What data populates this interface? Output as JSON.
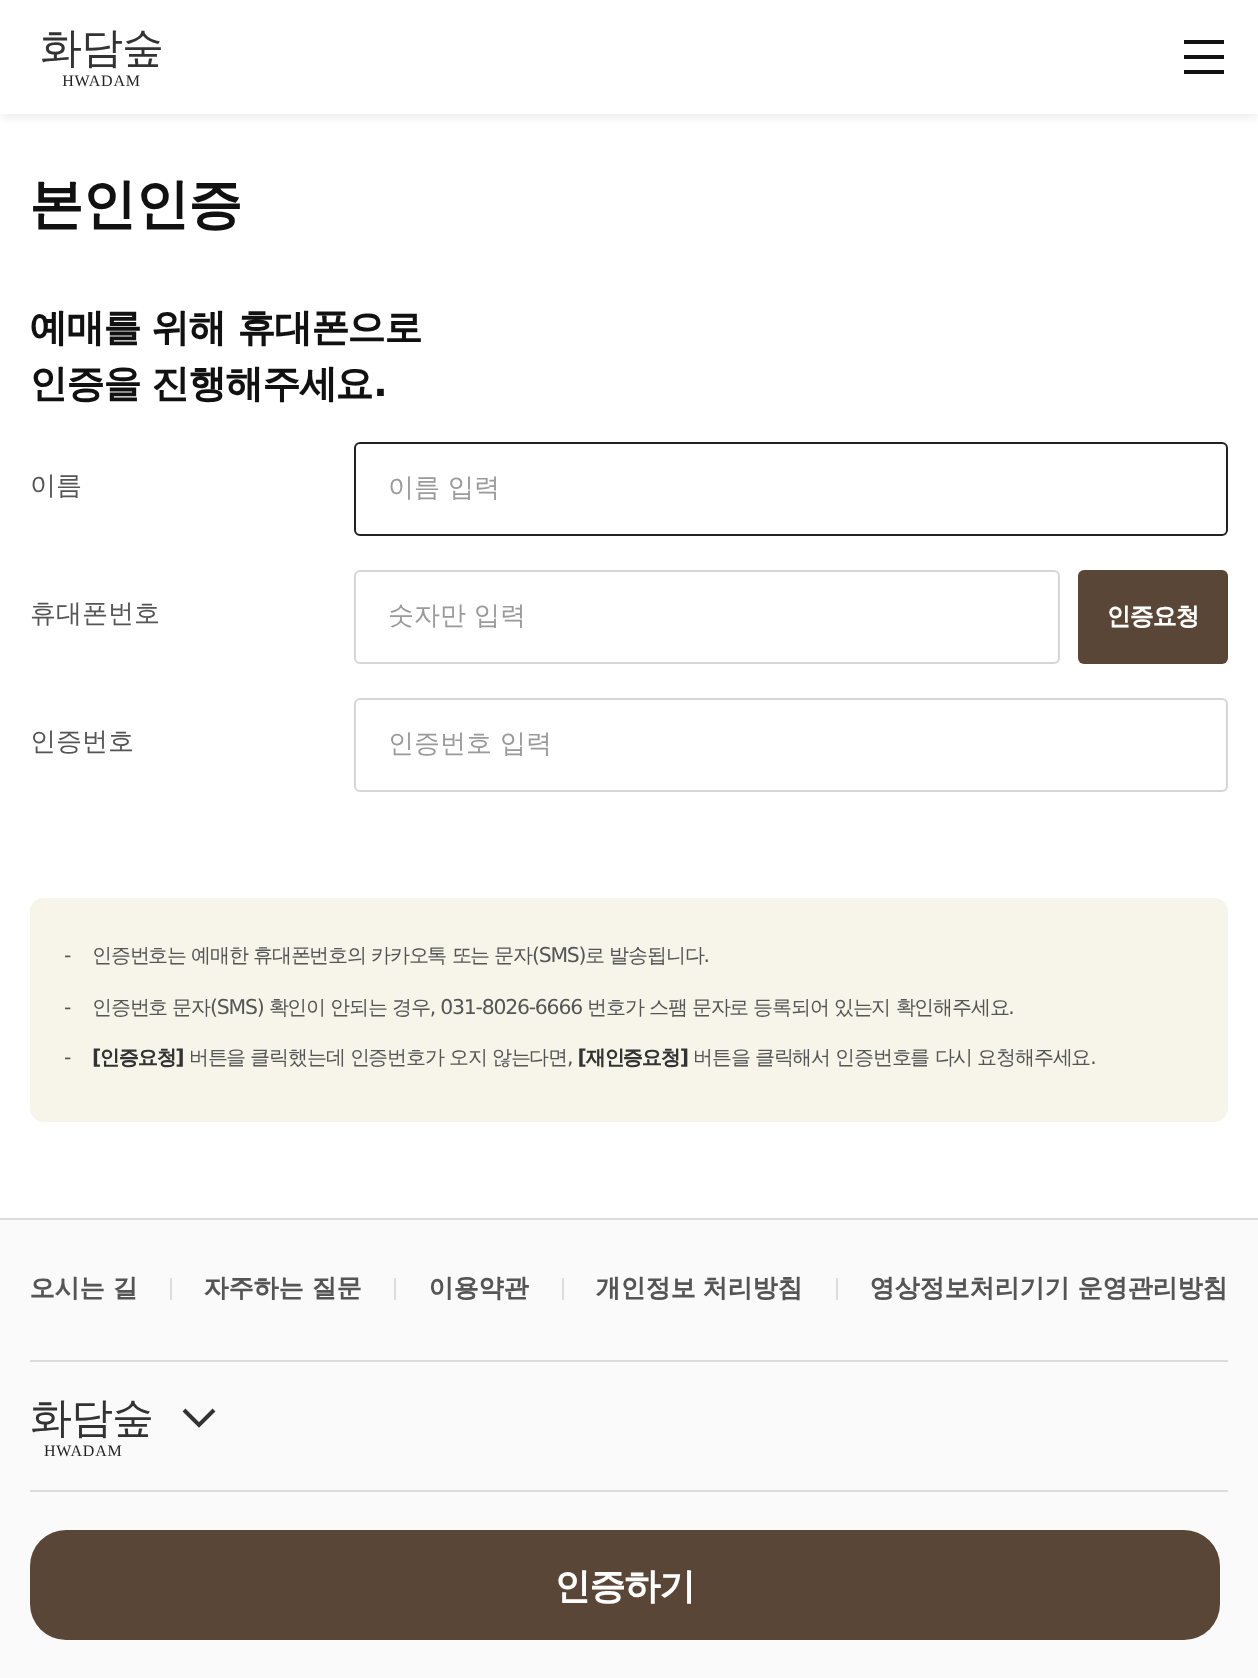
{
  "header": {
    "logo": {
      "name": "화담숲",
      "latin": "HWADAM"
    }
  },
  "page_title": "본인인증",
  "intro": "예매를 위해 휴대폰으로\n인증을 진행해주세요.",
  "form": {
    "fields": [
      {
        "label": "이름",
        "placeholder": "이름 입력",
        "focused": true
      },
      {
        "label": "휴대폰번호",
        "placeholder": "숫자만 입력",
        "focused": false,
        "button": "인증요청"
      },
      {
        "label": "인증번호",
        "placeholder": "인증번호 입력",
        "focused": false
      }
    ]
  },
  "notice": {
    "marker": "-",
    "items": [
      "인증번호는 예매한 휴대폰번호의 카카오톡 또는 문자(SMS)로 발송됩니다.",
      "인증번호 문자(SMS) 확인이 안되는 경우, 031-8026-6666 번호가 스팸 문자로 등록되어 있는지 확인해주세요.",
      "**[인증요청]** 버튼을 클릭했는데 인증번호가 오지 않는다면, **[재인증요청]** 버튼을 클릭해서 인증번호를 다시 요청해주세요."
    ]
  },
  "footer": {
    "links": [
      "오시는 길",
      "자주하는 질문",
      "이용약관",
      "개인정보 처리방침",
      "영상정보처리기기 운영관리방침"
    ],
    "logo": {
      "name": "화담숲",
      "latin": "HWADAM",
      "expanded": false
    }
  },
  "submit_button": "인증하기"
}
